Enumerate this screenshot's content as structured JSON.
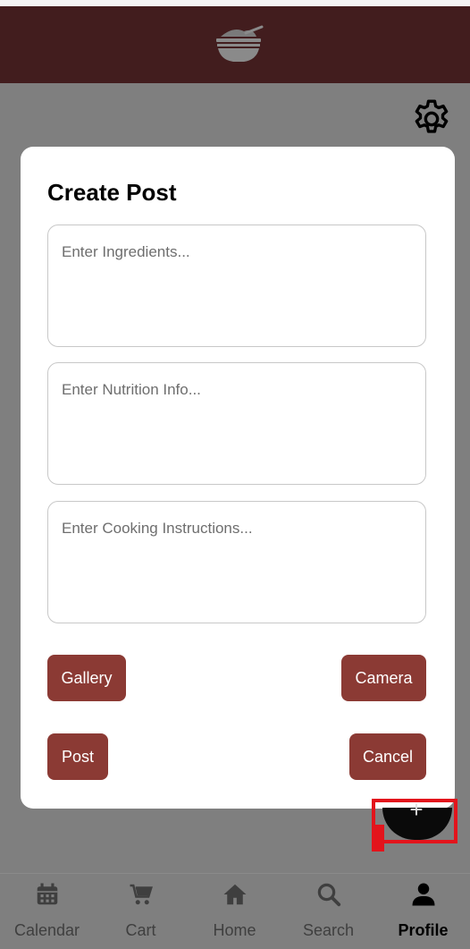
{
  "colors": {
    "header": "#421d1e",
    "button": "#8b3a34",
    "overlay": "#7f7f7f",
    "highlight": "#e3141c"
  },
  "header": {
    "logo_icon": "bowl-logo-icon"
  },
  "toolbar": {
    "settings_icon": "gear-icon"
  },
  "modal": {
    "title": "Create Post",
    "fields": {
      "ingredients_placeholder": "Enter Ingredients...",
      "nutrition_placeholder": "Enter Nutrition Info...",
      "instructions_placeholder": "Enter Cooking Instructions..."
    },
    "buttons": {
      "gallery": "Gallery",
      "camera": "Camera",
      "post": "Post",
      "cancel": "Cancel"
    }
  },
  "fab": {
    "icon": "plus-icon",
    "symbol": "+"
  },
  "bottom_nav": {
    "items": [
      {
        "label": "Calendar",
        "icon": "calendar-icon"
      },
      {
        "label": "Cart",
        "icon": "cart-icon"
      },
      {
        "label": "Home",
        "icon": "home-icon"
      },
      {
        "label": "Search",
        "icon": "search-icon"
      },
      {
        "label": "Profile",
        "icon": "profile-icon"
      }
    ],
    "active": "Profile"
  }
}
